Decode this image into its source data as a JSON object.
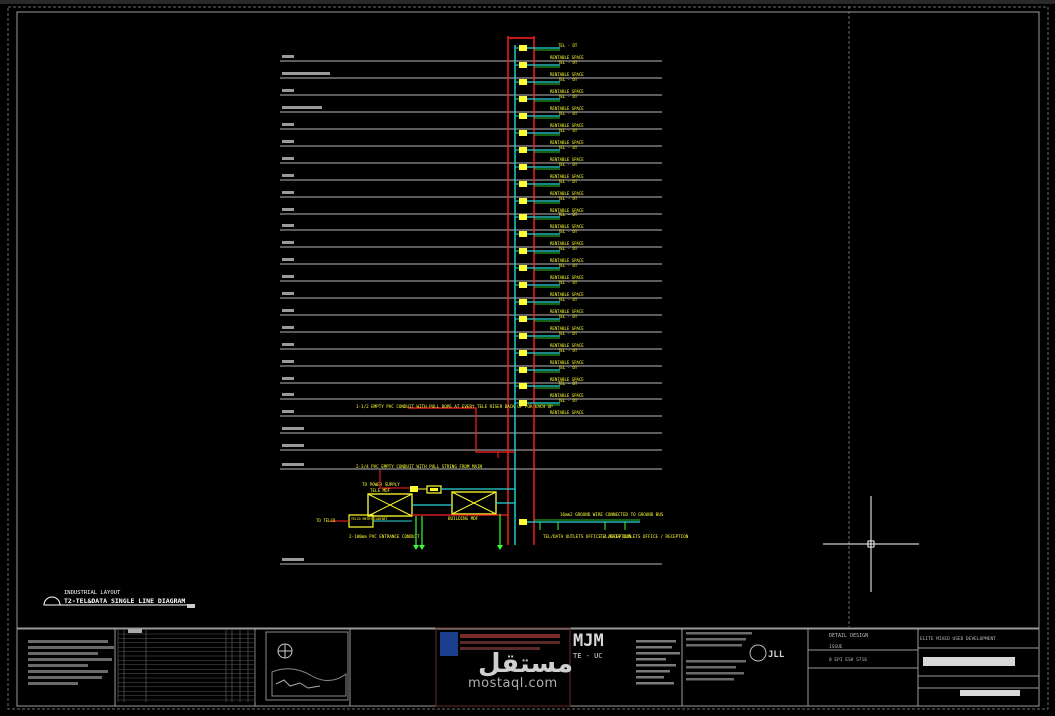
{
  "drawing": {
    "title_line1": "INDUSTRIAL LAYOUT",
    "title_line2": "T2-TEL&DATA SINGLE LINE DIAGRAM",
    "floor_label": "RENTABLE SPACE",
    "tel_label": "TEL - DT",
    "note_riser": "1-1/2 EMPTY PVC CONDUIT WITH PULL ROPE AT EVERY TELE RISER BACK UP FOR EACH UP",
    "note_entrance": "2-3/4 PVC EMPTY CONDUIT WITH PULL STRING FROM MAIN",
    "note_power": "TO POWER SUPPLY",
    "box_mdf": "TELE MDF",
    "box_bldg_mdf": "BUILDING MDF",
    "box_telco": "TELCO ENTRY CABINET",
    "note_pvc": "2-100mm PVC ENTRANCE CONDUIT",
    "note_telco": "TO TELCO",
    "note_ground": "16mm2 GROUND WIRE CONNECTED TO GROUND BUS",
    "outlet_1": "TEL/DATA OUTLETS OFFICE / RECEPTION",
    "outlet_2": "TEL/DATA OUTLETS OFFICE / RECEPTION"
  },
  "title_block": {
    "detail_design": "DETAIL DESIGN",
    "role": "ISSUE",
    "drawing_no": "0 EPI ESH S716",
    "project": "ELITE MIXED USED DEVELOPMENT",
    "brand_left": "MJM",
    "brand_sub": "TE - UC",
    "brand_right": "JLL"
  },
  "watermark": {
    "text": "mostaql.com",
    "logo_text": "مستقل"
  },
  "colors": {
    "background": "#000000",
    "floor_lines": "#b9b9b9",
    "riser_red": "#ff2020",
    "riser_cyan": "#26d6d6",
    "equipment_yellow": "#ffff33",
    "ground_green": "#33ff33",
    "border": "#9a9a9a"
  }
}
